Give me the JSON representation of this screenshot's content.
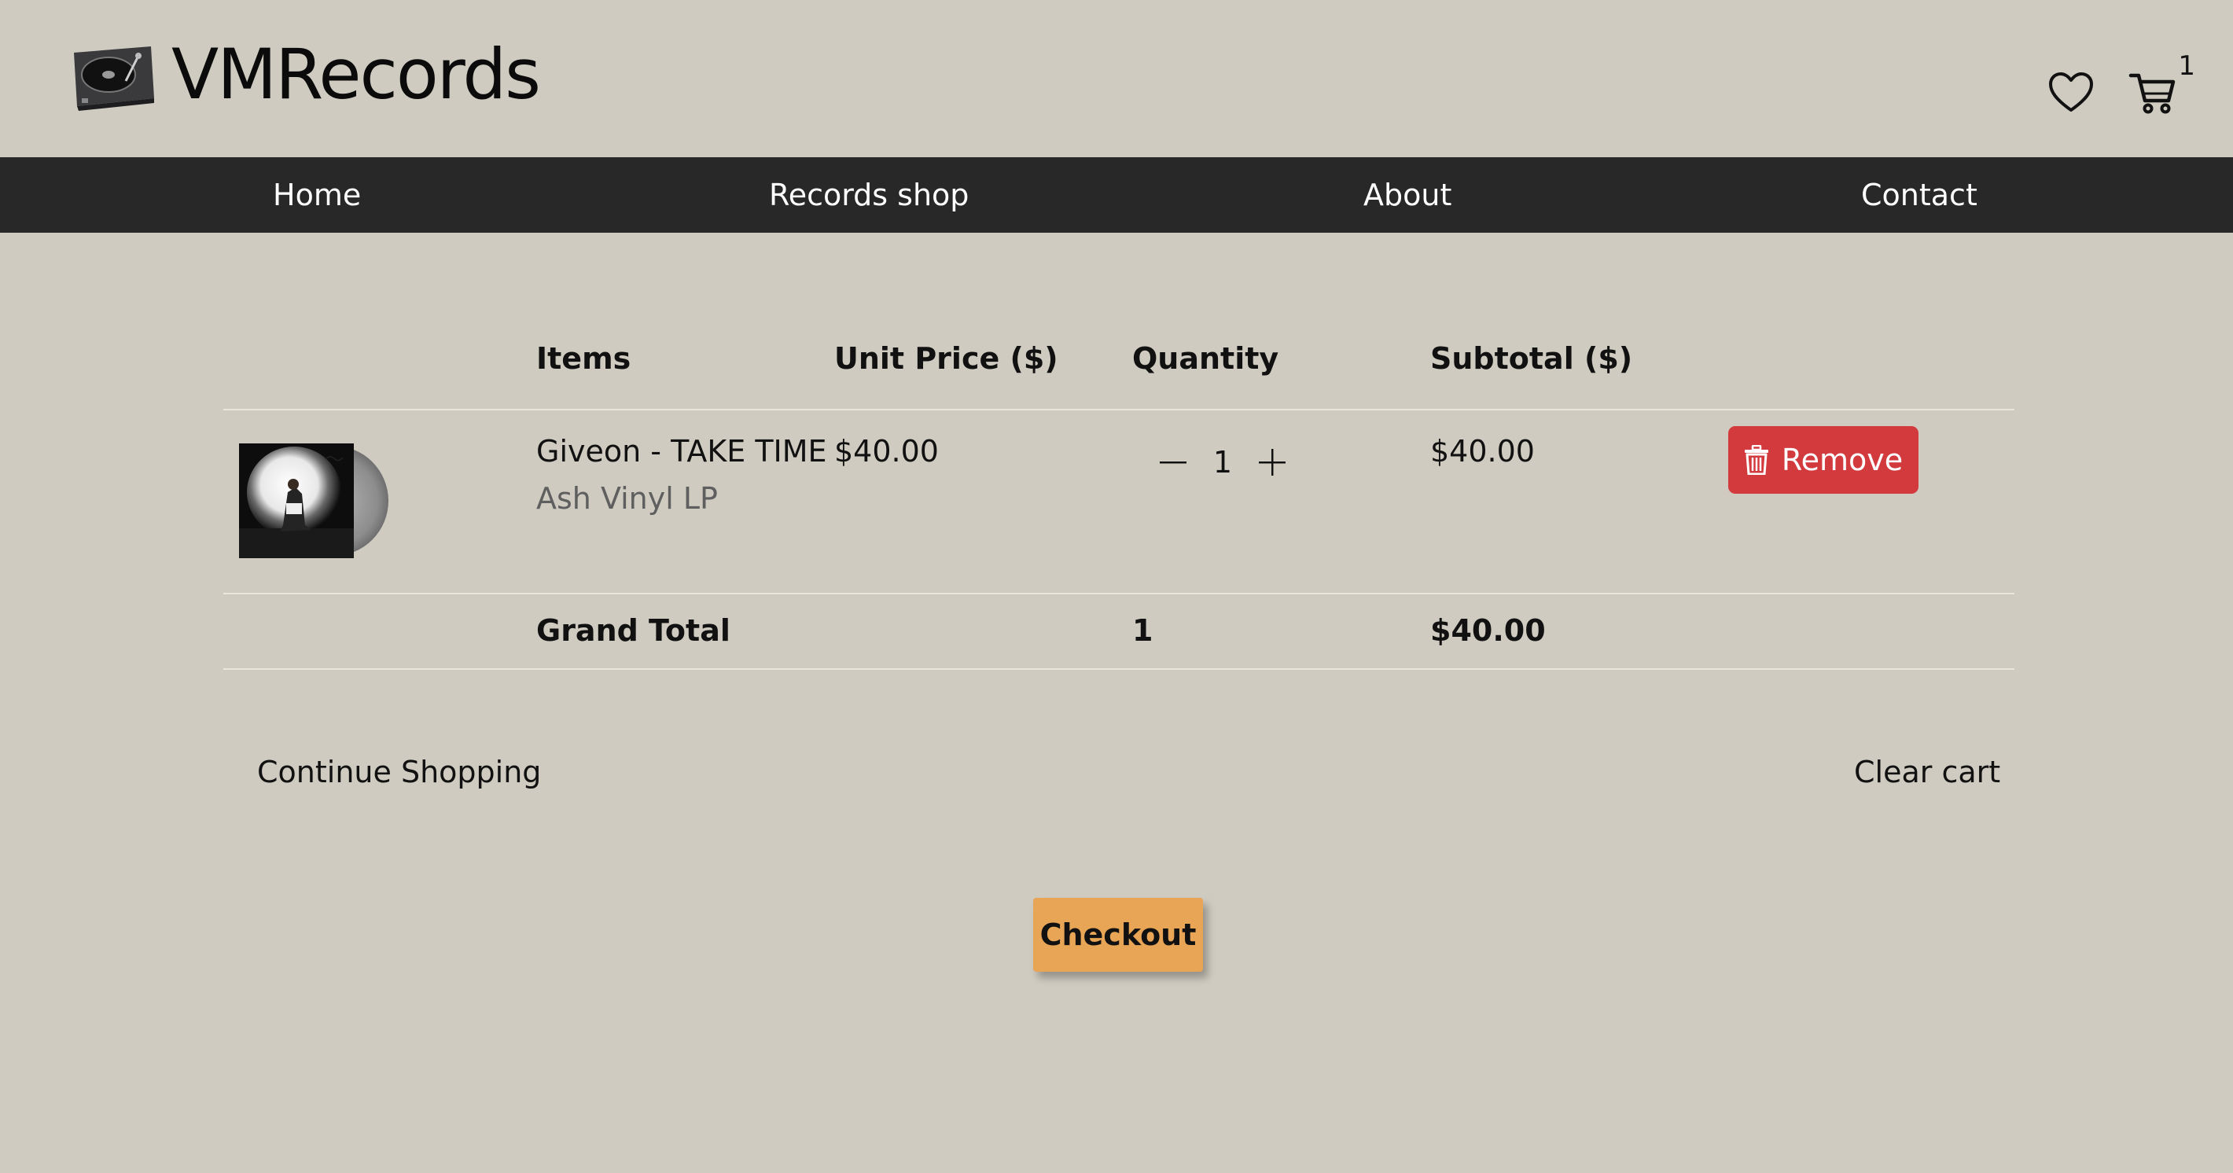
{
  "brand": {
    "name": "VMRecords",
    "logo_icon": "turntable-icon"
  },
  "header": {
    "wishlist_icon": "heart-icon",
    "cart_icon": "cart-icon",
    "cart_count": "1"
  },
  "nav": {
    "items": [
      {
        "label": "Home"
      },
      {
        "label": "Records shop"
      },
      {
        "label": "About"
      },
      {
        "label": "Contact"
      }
    ]
  },
  "cart": {
    "columns": {
      "items": "Items",
      "unit_price": "Unit Price ($)",
      "quantity": "Quantity",
      "subtotal": "Subtotal ($)"
    },
    "rows": [
      {
        "title": "Giveon - TAKE TIME",
        "variant": "Ash Vinyl LP",
        "unit_price": "$40.00",
        "quantity": "1",
        "subtotal": "$40.00",
        "remove_label": "Remove"
      }
    ],
    "grand_total": {
      "label": "Grand Total",
      "quantity": "1",
      "amount": "$40.00"
    }
  },
  "actions": {
    "continue_label": "Continue Shopping",
    "clear_label": "Clear cart",
    "checkout_label": "Checkout"
  },
  "colors": {
    "page_background": "#cfcbc0",
    "nav_background": "#282828",
    "remove_button": "#d33a3e",
    "checkout_button": "#e9a556"
  }
}
